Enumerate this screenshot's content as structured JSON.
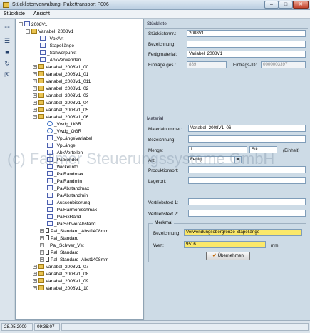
{
  "window": {
    "title": "Stücklistenverwaltung- Pakettransport P006"
  },
  "menu": [
    "Stückliste",
    "Ansicht"
  ],
  "tree": {
    "root": "2008V1",
    "parent": "Variabel_2008V1",
    "nodes": [
      "_VpkArt",
      "_Stapellänge",
      "_Schwerpunkt",
      "_AbkVerwenden",
      "Variabel_2008V1_00",
      "Variabel_2008V1_01",
      "Variabel_2008V1_011",
      "Variabel_2008V1_02",
      "Variabel_2008V1_03",
      "Variabel_2008V1_04",
      "Variabel_2008V1_05",
      "Variabel_2008V1_06"
    ],
    "children_06": [
      "_Vwdg_UGR",
      "_Vwdg_OGR",
      "_VpLängeVariabel",
      "_VpLänge",
      "_AbkVerteilen",
      "_PalSonder",
      "_WickelInfo",
      "_PalRandmax",
      "_PalRandmin",
      "_PalAbstandmax",
      "_PalAbstandmin",
      "_Aussenbiserung",
      "_PalHarmonischmax",
      "_PalFixRand",
      "_PalSchwerAbstand",
      "Pal_Standard_Abst1408mm",
      "Pal_Standard",
      "Pal_Schwer_Vst",
      "Pal_Standard",
      "Pal_Standard_Abst1408mm"
    ],
    "after": [
      "Variabel_2008V1_07",
      "Variabel_2008V1_08",
      "Variabel_2008V1_09",
      "Variabel_2008V1_10"
    ]
  },
  "stueckliste": {
    "header": "Stückliste",
    "nr_label": "Stücklistennr.:",
    "nr_value": "2008V1",
    "bezeichnung_label": "Bezeichnung:",
    "bezeichnung_value": "",
    "fertigmaterial_label": "Fertigmaterial:",
    "fertigmaterial_value": "Variabel_2008V1",
    "eintraege_label": "Einträge ges.:",
    "eintraege_value": "889",
    "eintrags_id_label": "Eintrags-ID:",
    "eintrags_id_value": "0000003397"
  },
  "material": {
    "header": "Material",
    "materialnummer_label": "Materialnummer:",
    "materialnummer_value": "Variabel_2008V1_06",
    "bezeichnung_label": "Bezeichnung:",
    "bezeichnung_value": "",
    "menge_label": "Menge:",
    "menge_value": "1",
    "einheit_value": "Stk",
    "einheit_label": "(Einheit)",
    "art_label": "Art:",
    "art_value": "Fertig",
    "produktionsort_label": "Produktionsort:",
    "produktionsort_value": "",
    "lagerort_label": "Lagerort:",
    "lagerort_value": "",
    "vertriebstext1_label": "Vertriebstext 1:",
    "vertriebstext1_value": "",
    "vertriebstext2_label": "Vertriebstext 2:",
    "vertriebstext2_value": ""
  },
  "merkmal": {
    "header": "Merkmal",
    "bezeichnung_label": "Bezeichnung:",
    "bezeichnung_value": "Verwendungsobergrenze Stapellänge",
    "wert_label": "Wert:",
    "wert_value": "9516",
    "unit": "mm",
    "apply_button": "Übernehmen"
  },
  "status": {
    "date": "28.05.2009",
    "time": "09:36:07"
  },
  "watermark": "(c) Fallmer Steuerungssysteme GmbH",
  "colors": {
    "highlight": "#fbe86a",
    "panel": "#cddbe6"
  }
}
